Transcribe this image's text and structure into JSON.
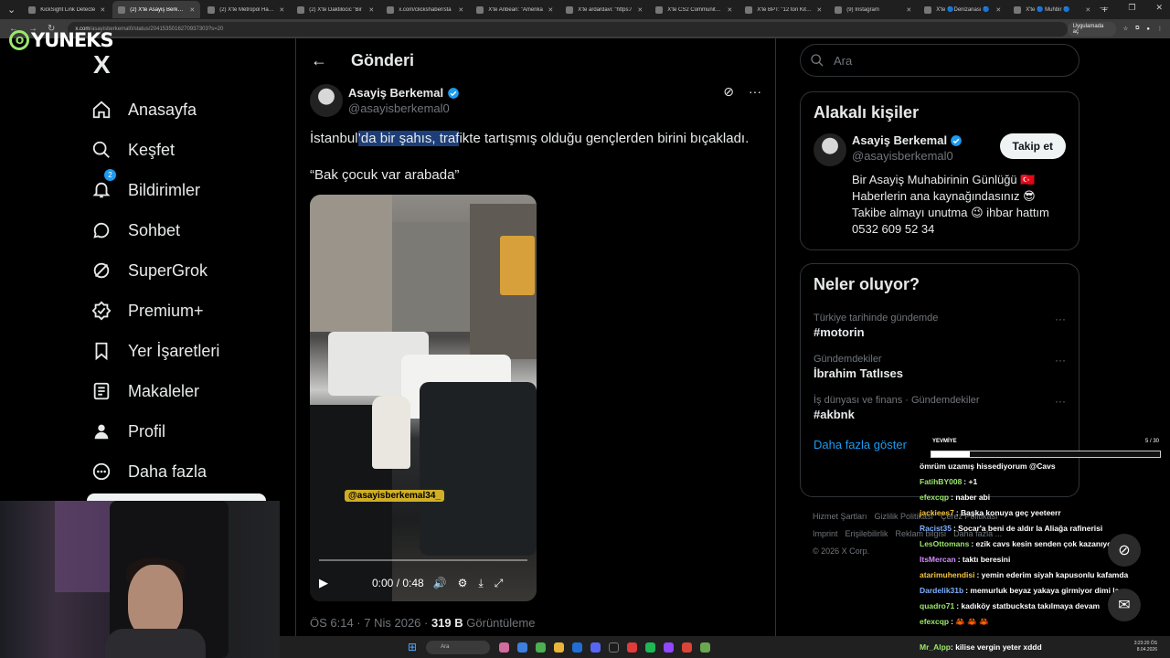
{
  "browser": {
    "tabs": [
      {
        "title": "KickSight Link Detecte",
        "active": false
      },
      {
        "title": "(2) X'te Asayiş Berkem",
        "active": true
      },
      {
        "title": "(2) X'te Metropol Habe",
        "active": false
      },
      {
        "title": "(2) X'te Daktilocic \"Bir",
        "active": false
      },
      {
        "title": "x.com/clickshaber/sta",
        "active": false
      },
      {
        "title": "X'te Anbean: \"Amerika",
        "active": false
      },
      {
        "title": "X'te ardardavi: \"https:/",
        "active": false
      },
      {
        "title": "X'te CS2 Community: \"",
        "active": false
      },
      {
        "title": "X'te BPT: \"12 ton KitKa",
        "active": false
      },
      {
        "title": "(9) Instagram",
        "active": false
      },
      {
        "title": "X'te 🔵Denizanası 🔵",
        "active": false
      },
      {
        "title": "X'te 🔵 Muhbir 🔵 ",
        "active": false
      }
    ],
    "url_host": "x.com",
    "url_path": "/asayisberkemal0/status/2041535016270937303?s=20",
    "app_button": "Uygulamada aç"
  },
  "watermark": {
    "text": "YUNEKS",
    "circle_letter": "O"
  },
  "nav": {
    "logo": "X",
    "items": [
      {
        "label": "Anasayfa",
        "icon": "home-icon"
      },
      {
        "label": "Keşfet",
        "icon": "search-icon"
      },
      {
        "label": "Bildirimler",
        "icon": "bell-icon",
        "badge": "2"
      },
      {
        "label": "Sohbet",
        "icon": "chat-icon"
      },
      {
        "label": "SuperGrok",
        "icon": "grok-icon"
      },
      {
        "label": "Premium+",
        "icon": "premium-icon"
      },
      {
        "label": "Yer İşaretleri",
        "icon": "bookmark-icon"
      },
      {
        "label": "Makaleler",
        "icon": "article-icon"
      },
      {
        "label": "Profil",
        "icon": "profile-icon"
      },
      {
        "label": "Daha fazla",
        "icon": "more-icon"
      }
    ]
  },
  "post": {
    "header": "Gönderi",
    "author_name": "Asayiş Berkemal",
    "author_handle": "@asayisberkemal0",
    "text_before": "İstanbul",
    "text_highlight": "’da bir şahıs, traf",
    "text_after": "ikte tartışmış olduğu gençlerden birini bıçakladı.",
    "quote": "“Bak çocuk var arabada”",
    "video_tag": "@asayisberkemal34_",
    "video_time": "0:00 / 0:48",
    "meta_time": "ÖS 6:14 · 7 Nis 2026 · ",
    "views_count": "319 B",
    "views_label": " Görüntüleme"
  },
  "right": {
    "search_placeholder": "Ara",
    "related_title": "Alakalı kişiler",
    "related": {
      "name": "Asayiş Berkemal",
      "handle": "@asayisberkemal0",
      "follow": "Takip et",
      "bio_1": "Bir Asayiş Muhabirinin Günlüğü 🇹🇷",
      "bio_2": "Haberlerin ana kaynağındasınız 😎",
      "bio_3": "Takibe almayı unutma 😉 ihbar hattım",
      "bio_4": "0532 609 52 34"
    },
    "trends_title": "Neler oluyor?",
    "trends": [
      {
        "context": "Türkiye tarihinde gündemde",
        "tag": "#motorin"
      },
      {
        "context": "Gündemdekiler",
        "tag": "İbrahim Tatlıses"
      },
      {
        "context": "İş dünyası ve finans · Gündemdekiler",
        "tag": "#akbnk"
      }
    ],
    "show_more": "Daha fazla göster",
    "footer": [
      "Hizmet Şartları",
      "Gizlilik Politikası",
      "Çerez Politikası",
      "Imprint",
      "Erişilebilirlik",
      "Reklam bilgisi",
      "Daha fazla ...",
      "© 2026 X Corp."
    ]
  },
  "overlay": {
    "label": "YEVMİYE",
    "count": "5 / 30",
    "progress_fraction": 0.167
  },
  "chat": [
    {
      "user": "",
      "text": "ömrüm uzamış hissediyorum @Cavs",
      "color": "#ffffff"
    },
    {
      "user": "FatihBY008",
      "text": ": +1",
      "color": "#9be86b"
    },
    {
      "user": "efexcqp",
      "text": ": naber abi",
      "color": "#9be86b"
    },
    {
      "user": "jackiees7",
      "text": ": Başka konuya geç yeeteerr",
      "color": "#f5c542"
    },
    {
      "user": "Racist35",
      "text": ": Socar'a beni de aldır la Aliağa rafinerisi",
      "color": "#7fb0ff"
    },
    {
      "user": "LesOttomans",
      "text": ": ezik cavs kesin senden çok kazanıyorum",
      "color": "#9be86b"
    },
    {
      "user": "ItsMercan",
      "text": ": taktı beresini",
      "color": "#d58cff"
    },
    {
      "user": "atarimuhendisi",
      "text": ": yemin ederim siyah kapusonlu kafamda",
      "color": "#f5c542"
    },
    {
      "user": "Dardelik31b",
      "text": ": memurluk beyaz yakaya girmiyor dimi la",
      "color": "#7fb0ff"
    },
    {
      "user": "quadro71",
      "text": ": kadıköy statbucksta takılmaya devam",
      "color": "#9be86b"
    },
    {
      "user": "efexcqp",
      "text": ": 🦀 🦀 🦀",
      "color": "#9be86b"
    }
  ],
  "sticky_chat": {
    "user": "Mr_Alpp",
    "text": ": kilise vergin yeter xddd",
    "color": "#9be86b"
  },
  "taskbar": {
    "search": "Ara",
    "time": "3:23:20 ÖS",
    "date": "8.04.2026"
  }
}
